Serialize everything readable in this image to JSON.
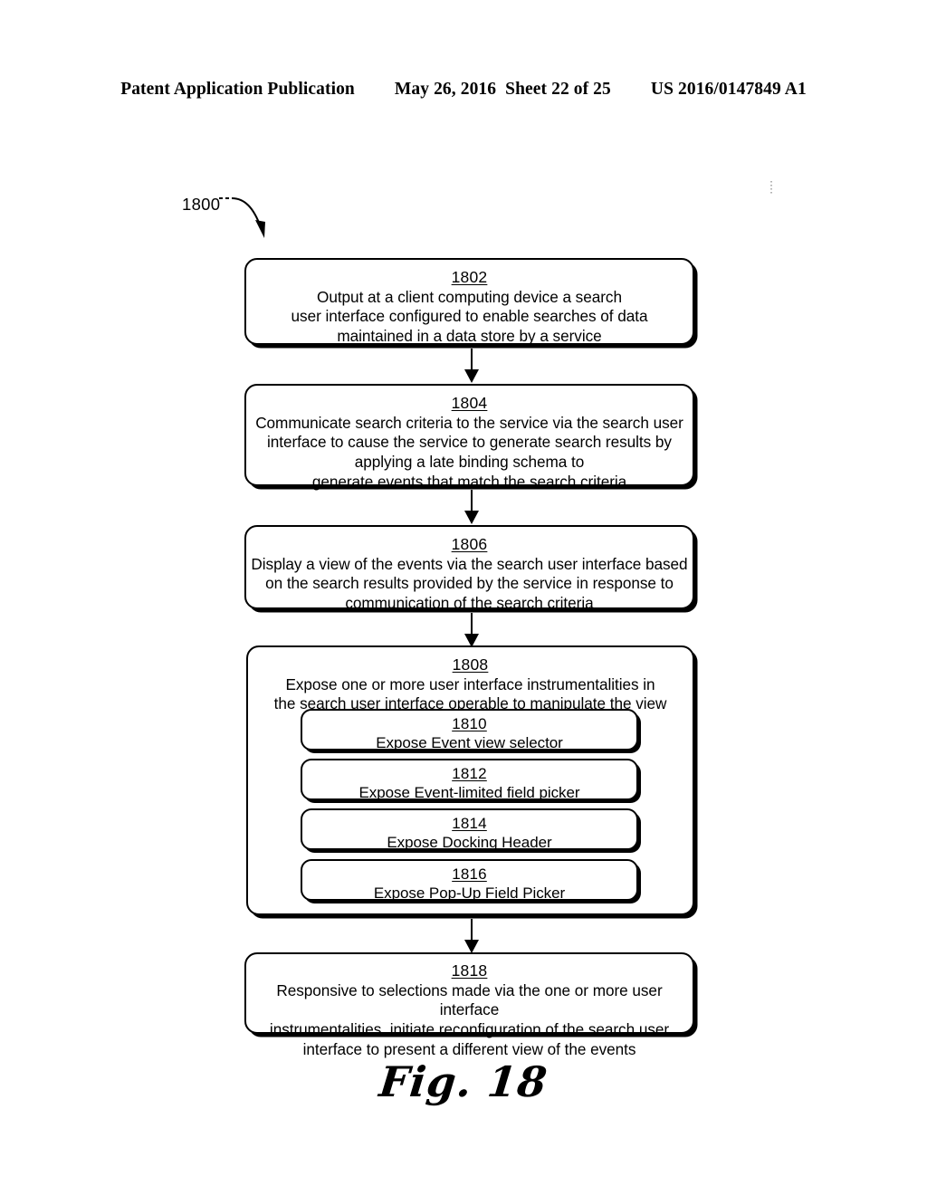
{
  "header": {
    "publication": "Patent Application Publication",
    "date": "May 26, 2016",
    "sheet": "Sheet 22 of 25",
    "patent_number": "US 2016/0147849 A1"
  },
  "figure": {
    "caption": "Fig. 18",
    "diagram_ref": "1800"
  },
  "flow": {
    "steps": [
      {
        "num": "1802",
        "text": "Output at a client computing device a search\nuser interface configured to enable searches of data\nmaintained in a data store by a service"
      },
      {
        "num": "1804",
        "text": "Communicate search criteria to the service via the search user\ninterface to cause the service to generate search results by\napplying a late binding schema to\ngenerate events that match the search criteria"
      },
      {
        "num": "1806",
        "text": "Display a view of the events via the search user interface based\non the search results provided by the service in response to\ncommunication of the search criteria"
      },
      {
        "num": "1808",
        "text": "Expose one or more user interface instrumentalities in\nthe search user interface operable to manipulate the view",
        "substeps": [
          {
            "num": "1810",
            "text": "Expose Event view selector"
          },
          {
            "num": "1812",
            "text": "Expose Event-limited field picker"
          },
          {
            "num": "1814",
            "text": "Expose Docking Header"
          },
          {
            "num": "1816",
            "text": "Expose Pop-Up Field  Picker"
          }
        ]
      },
      {
        "num": "1818",
        "text": "Responsive to selections made via the one or more user interface\ninstrumentalities,  initiate reconfiguration of the search user\ninterface to present a different view of the events"
      }
    ]
  },
  "colors": {
    "ink": "#000000",
    "paper": "#ffffff"
  }
}
